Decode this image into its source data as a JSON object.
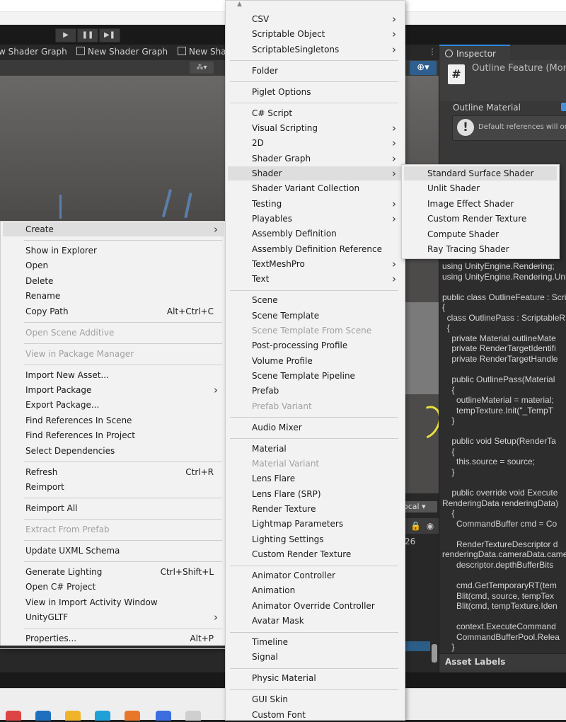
{
  "editor": {
    "tabs": [
      "w Shader Graph",
      "New Shader Graph",
      "New Shad"
    ],
    "inspector": {
      "tab_label": "Inspector",
      "title": "Outline Feature (Mono",
      "outline_material_label": "Outline Material",
      "warning_text": "Default references will only",
      "asset_labels": "Asset Labels",
      "code_lines": [
        "using UnityEngine.Rendering;",
        "using UnityEngine.Rendering.Uni",
        "",
        "public class OutlineFeature : Scri",
        "{",
        "  class OutlinePass : ScriptableR",
        "  {",
        "    private Material outlineMate",
        "    private RenderTargetIdentifi",
        "    private RenderTargetHandle",
        "",
        "    public OutlinePass(Material",
        "    {",
        "      outlineMaterial = material;",
        "      tempTexture.Init(\"_TempT",
        "    }",
        "",
        "    public void Setup(RenderTa",
        "    {",
        "      this.source = source;",
        "    }",
        "",
        "    public override void Execute",
        "RenderingData renderingData)",
        "    {",
        "      CommandBuffer cmd = Co",
        "",
        "      RenderTextureDescriptor d",
        "renderingData.cameraData.came",
        "      descriptor.depthBufferBits",
        "",
        "      cmd.GetTemporaryRT(tem",
        "      Blit(cmd, source, tempTex",
        "      Blit(cmd, tempTexture.Iden",
        "",
        "      context.ExecuteCommand",
        "      CommandBufferPool.Relea",
        "    }"
      ]
    },
    "project": {
      "local_label": "ocal",
      "count": "26"
    }
  },
  "left_menu": {
    "items": [
      {
        "label": "Create",
        "submenu": true,
        "highlighted": true
      },
      {
        "sep": true
      },
      {
        "label": "Show in Explorer"
      },
      {
        "label": "Open"
      },
      {
        "label": "Delete"
      },
      {
        "label": "Rename"
      },
      {
        "label": "Copy Path",
        "shortcut": "Alt+Ctrl+C"
      },
      {
        "sep": true
      },
      {
        "label": "Open Scene Additive",
        "disabled": true
      },
      {
        "sep": true
      },
      {
        "label": "View in Package Manager",
        "disabled": true
      },
      {
        "sep": true
      },
      {
        "label": "Import New Asset..."
      },
      {
        "label": "Import Package",
        "submenu": true
      },
      {
        "label": "Export Package..."
      },
      {
        "label": "Find References In Scene"
      },
      {
        "label": "Find References In Project"
      },
      {
        "label": "Select Dependencies"
      },
      {
        "sep": true
      },
      {
        "label": "Refresh",
        "shortcut": "Ctrl+R"
      },
      {
        "label": "Reimport"
      },
      {
        "sep": true
      },
      {
        "label": "Reimport All"
      },
      {
        "sep": true
      },
      {
        "label": "Extract From Prefab",
        "disabled": true
      },
      {
        "sep": true
      },
      {
        "label": "Update UXML Schema"
      },
      {
        "sep": true
      },
      {
        "label": "Generate Lighting",
        "shortcut": "Ctrl+Shift+L"
      },
      {
        "label": "Open C# Project"
      },
      {
        "label": "View in Import Activity Window"
      },
      {
        "label": "UnityGLTF",
        "submenu": true
      },
      {
        "sep": true
      },
      {
        "label": "Properties...",
        "shortcut": "Alt+P"
      }
    ]
  },
  "create_menu": {
    "items": [
      {
        "label": "CSV",
        "submenu": true
      },
      {
        "label": "Scriptable Object",
        "submenu": true
      },
      {
        "label": "ScriptableSingletons",
        "submenu": true
      },
      {
        "sep": true
      },
      {
        "label": "Folder"
      },
      {
        "sep": true
      },
      {
        "label": "Piglet Options"
      },
      {
        "sep": true
      },
      {
        "label": "C# Script"
      },
      {
        "label": "Visual Scripting",
        "submenu": true
      },
      {
        "label": "2D",
        "submenu": true
      },
      {
        "label": "Shader Graph",
        "submenu": true
      },
      {
        "label": "Shader",
        "submenu": true,
        "highlighted": true
      },
      {
        "label": "Shader Variant Collection"
      },
      {
        "label": "Testing",
        "submenu": true
      },
      {
        "label": "Playables",
        "submenu": true
      },
      {
        "label": "Assembly Definition"
      },
      {
        "label": "Assembly Definition Reference"
      },
      {
        "label": "TextMeshPro",
        "submenu": true
      },
      {
        "label": "Text",
        "submenu": true
      },
      {
        "sep": true
      },
      {
        "label": "Scene"
      },
      {
        "label": "Scene Template"
      },
      {
        "label": "Scene Template From Scene",
        "disabled": true
      },
      {
        "label": "Post-processing Profile"
      },
      {
        "label": "Volume Profile"
      },
      {
        "label": "Scene Template Pipeline"
      },
      {
        "label": "Prefab"
      },
      {
        "label": "Prefab Variant",
        "disabled": true
      },
      {
        "sep": true
      },
      {
        "label": "Audio Mixer"
      },
      {
        "sep": true
      },
      {
        "label": "Material"
      },
      {
        "label": "Material Variant",
        "disabled": true
      },
      {
        "label": "Lens Flare"
      },
      {
        "label": "Lens Flare (SRP)"
      },
      {
        "label": "Render Texture"
      },
      {
        "label": "Lightmap Parameters"
      },
      {
        "label": "Lighting Settings"
      },
      {
        "label": "Custom Render Texture"
      },
      {
        "sep": true
      },
      {
        "label": "Animator Controller"
      },
      {
        "label": "Animation"
      },
      {
        "label": "Animator Override Controller"
      },
      {
        "label": "Avatar Mask"
      },
      {
        "sep": true
      },
      {
        "label": "Timeline"
      },
      {
        "label": "Signal"
      },
      {
        "sep": true
      },
      {
        "label": "Physic Material"
      },
      {
        "sep": true
      },
      {
        "label": "GUI Skin"
      },
      {
        "label": "Custom Font"
      }
    ]
  },
  "shader_menu": {
    "items": [
      {
        "label": "Standard Surface Shader",
        "highlighted": true
      },
      {
        "label": "Unlit Shader"
      },
      {
        "label": "Image Effect Shader"
      },
      {
        "label": "Custom Render Texture"
      },
      {
        "label": "Compute Shader"
      },
      {
        "label": "Ray Tracing Shader"
      }
    ]
  }
}
